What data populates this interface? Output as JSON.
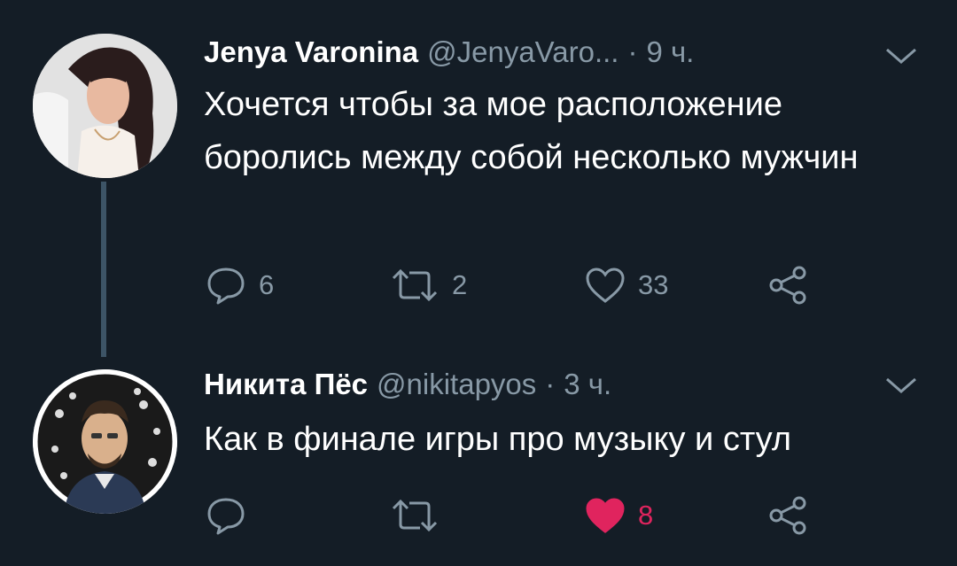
{
  "tweets": [
    {
      "author_name": "Jenya Varonina",
      "handle": "@JenyaVaro...",
      "separator": "·",
      "time": "9 ч.",
      "text": "Хочется чтобы за мое расположение боролись между собой несколько мужчин",
      "replies": "6",
      "retweets": "2",
      "likes": "33",
      "liked": false
    },
    {
      "author_name": "Никита Пёс",
      "handle": "@nikitapyos",
      "separator": "·",
      "time": "3 ч.",
      "text": "Как в финале игры про музыку и стул",
      "replies": "",
      "retweets": "",
      "likes": "8",
      "liked": true
    }
  ],
  "colors": {
    "background": "#141d26",
    "secondary_text": "#8899a6",
    "like_active": "#e0245e",
    "thread_line": "#3d5466"
  },
  "icons": [
    "reply-icon",
    "retweet-icon",
    "like-icon",
    "share-icon",
    "chevron-down-icon"
  ]
}
